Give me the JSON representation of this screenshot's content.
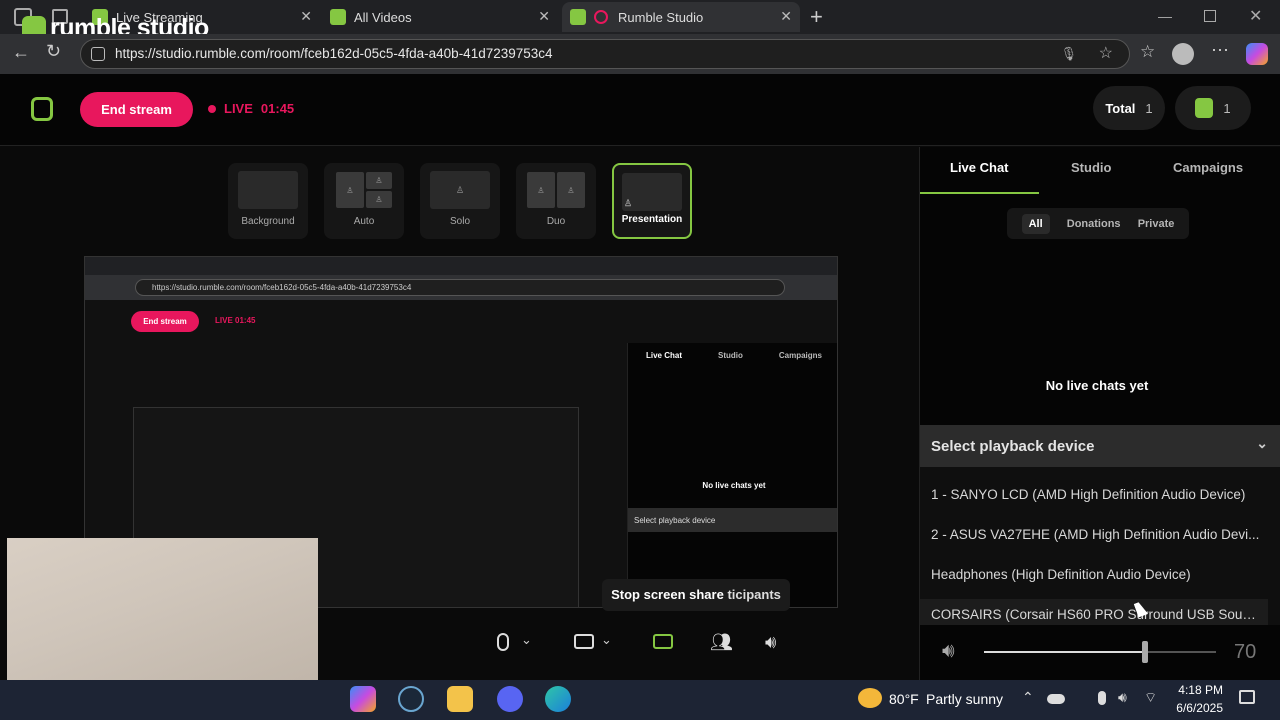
{
  "browser": {
    "tabs": [
      {
        "title": "Live Streaming"
      },
      {
        "title": "All Videos"
      },
      {
        "title": "Rumble Studio"
      }
    ],
    "url": "https://studio.rumble.com/room/fceb162d-05c5-4fda-a40b-41d7239753c4",
    "logo_text": "rumble studio"
  },
  "header": {
    "end_stream_label": "End stream",
    "live_label": "LIVE",
    "live_time": "01:45",
    "total_label": "Total",
    "total_count": "1",
    "rumble_count": "1"
  },
  "layouts": [
    {
      "label": "Background"
    },
    {
      "label": "Auto"
    },
    {
      "label": "Solo"
    },
    {
      "label": "Duo"
    },
    {
      "label": "Presentation",
      "selected": true
    }
  ],
  "right_panel": {
    "tabs": [
      "Live Chat",
      "Studio",
      "Campaigns"
    ],
    "filters": [
      "All",
      "Donations",
      "Private"
    ],
    "empty_text": "No live chats yet",
    "playback_title": "Select playback device",
    "devices": [
      "1 - SANYO LCD (AMD High Definition Audio Device)",
      "2 - ASUS VA27EHE (AMD High Definition Audio Devi...",
      "Headphones (High Definition Audio Device)",
      "CORSAIRS (Corsair HS60 PRO Surround USB Sound..."
    ],
    "volume": "70"
  },
  "toolbar": {
    "stop_share_label": "Stop screen share",
    "participants_tooltip_fragment": "ticipants"
  },
  "taskbar": {
    "weather_temp": "80°F",
    "weather_text": "Partly sunny",
    "time": "4:18 PM",
    "date": "6/6/2025"
  },
  "colors": {
    "accent_green": "#85c742",
    "live_red": "#e8175d"
  }
}
